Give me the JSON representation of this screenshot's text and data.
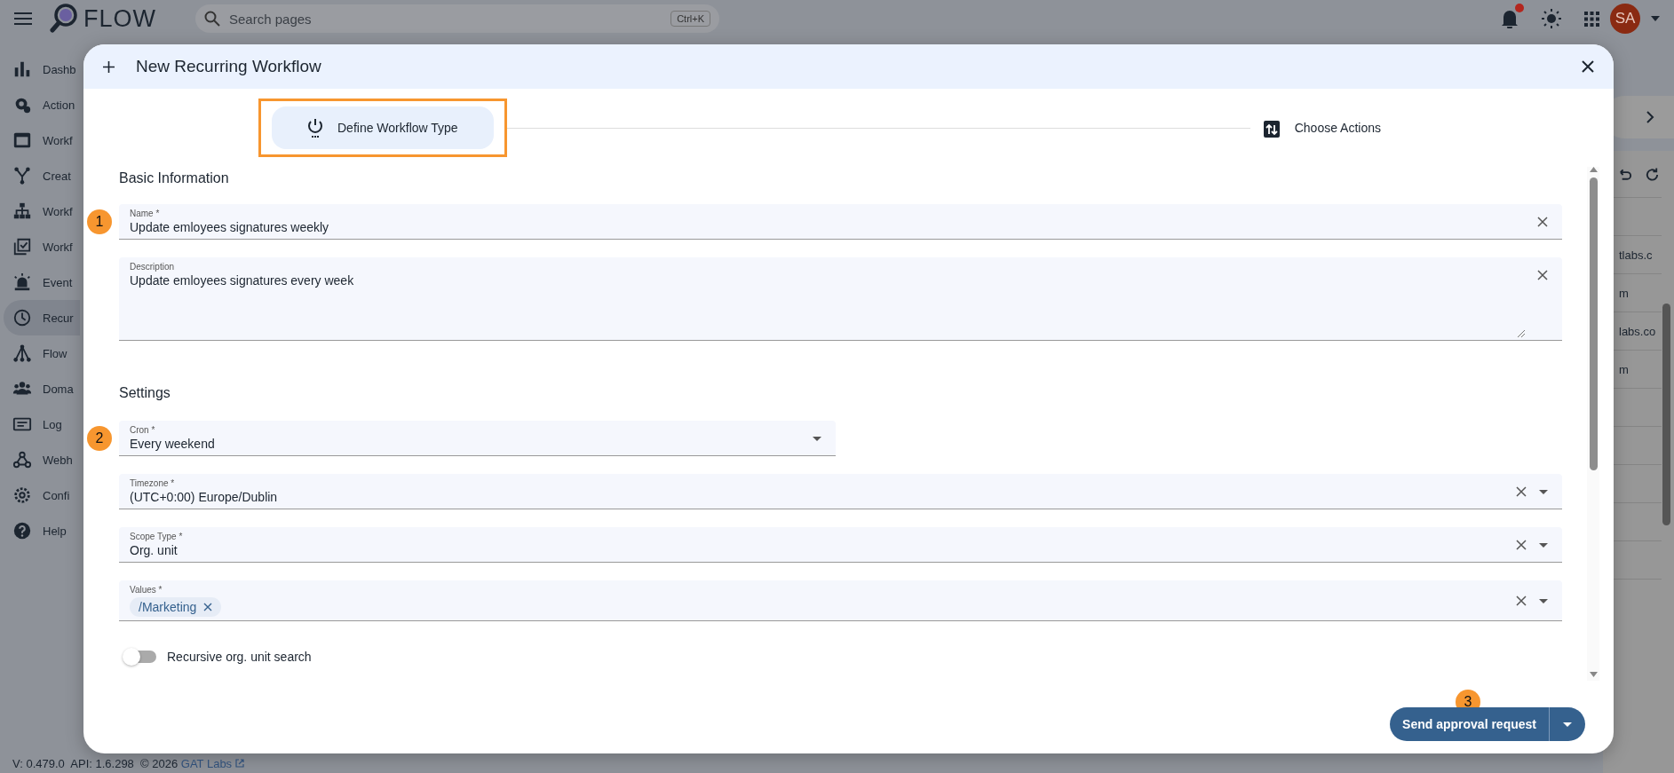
{
  "header": {
    "logo_text": "FLOW",
    "search": {
      "placeholder": "Search pages",
      "shortcut": "Ctrl+K"
    },
    "notifications_unread": true,
    "avatar": "SA"
  },
  "sidebar": {
    "items": [
      {
        "label": "Dashb",
        "selected": false
      },
      {
        "label": "Action",
        "selected": false
      },
      {
        "label": "Workf",
        "selected": false
      },
      {
        "label": "Creat",
        "selected": false
      },
      {
        "label": "Workf",
        "selected": false
      },
      {
        "label": "Workf",
        "selected": false
      },
      {
        "label": "Event",
        "selected": false
      },
      {
        "label": "Recur",
        "selected": true
      },
      {
        "label": "Flow",
        "selected": false
      },
      {
        "label": "Doma",
        "selected": false
      },
      {
        "label": "Log",
        "selected": false
      },
      {
        "label": "Webh",
        "selected": false
      },
      {
        "label": "Confi",
        "selected": false
      },
      {
        "label": "Help",
        "selected": false
      }
    ]
  },
  "background_table": {
    "cells": [
      "tlabs.c",
      "m",
      "labs.co",
      "m"
    ]
  },
  "footer": {
    "text": "V: 0.479.0  API: 1.6.298  © 2026 ",
    "link": "GAT Labs"
  },
  "dialog": {
    "title": "New Recurring Workflow",
    "steps": [
      {
        "label": "Define Workflow Type",
        "selected": true,
        "highlighted": true
      },
      {
        "label": "Choose Actions",
        "selected": false,
        "highlighted": false
      }
    ],
    "sections": [
      {
        "title": "Basic Information",
        "fields": [
          {
            "kind": "text",
            "label": "Name *",
            "value": "Update emloyees signatures weekly",
            "clearable": true,
            "marker": "1"
          },
          {
            "kind": "textarea",
            "label": "Description",
            "value": "Update emloyees signatures every week",
            "clearable": true
          }
        ]
      },
      {
        "title": "Settings",
        "fields": [
          {
            "kind": "select",
            "label": "Cron *",
            "value": "Every weekend",
            "clearable": false,
            "marker": "2"
          },
          {
            "kind": "select",
            "label": "Timezone *",
            "value": "(UTC+0:00) Europe/Dublin",
            "clearable": true
          },
          {
            "kind": "select",
            "label": "Scope Type *",
            "value": "Org. unit",
            "clearable": true
          },
          {
            "kind": "chips",
            "label": "Values *",
            "chips": [
              "/Marketing"
            ],
            "clearable": true
          },
          {
            "kind": "toggle",
            "label": "Recursive org. unit search",
            "on": false
          }
        ]
      }
    ],
    "primary_action": {
      "label": "Send approval request",
      "marker": "3"
    }
  }
}
